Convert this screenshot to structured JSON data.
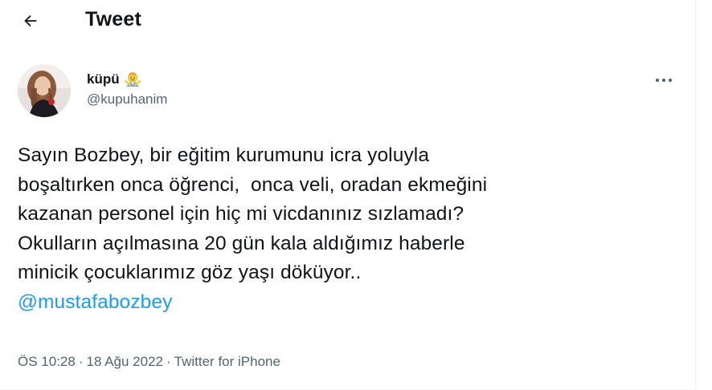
{
  "header": {
    "back_icon": "arrow-left-icon",
    "title": "Tweet"
  },
  "author": {
    "display_name": "küpü",
    "name_emoji": "person-gesturing-no-emoji",
    "handle": "@kupuhanim",
    "avatar": "profile-photo"
  },
  "more_icon": "ellipsis-icon",
  "tweet": {
    "lines": [
      "Sayın Bozbey, bir eğitim kurumunu icra yoluyla",
      "boşaltırken onca öğrenci,  onca veli, oradan ekmeğini",
      "kazanan personel için hiç mi vicdanınız sızlamadı?",
      "Okulların açılmasına 20 gün kala aldığımız haberle",
      "minicik çocuklarımız göz yaşı döküyor.."
    ],
    "mention": "@mustafabozbey"
  },
  "meta": {
    "time": "ÖS 10:28",
    "separator1": "·",
    "date": "18 Ağu 2022",
    "separator2": "·",
    "source": "Twitter for iPhone"
  },
  "colors": {
    "text": "#0f1419",
    "secondary": "#536471",
    "link": "#1d9bf0"
  }
}
